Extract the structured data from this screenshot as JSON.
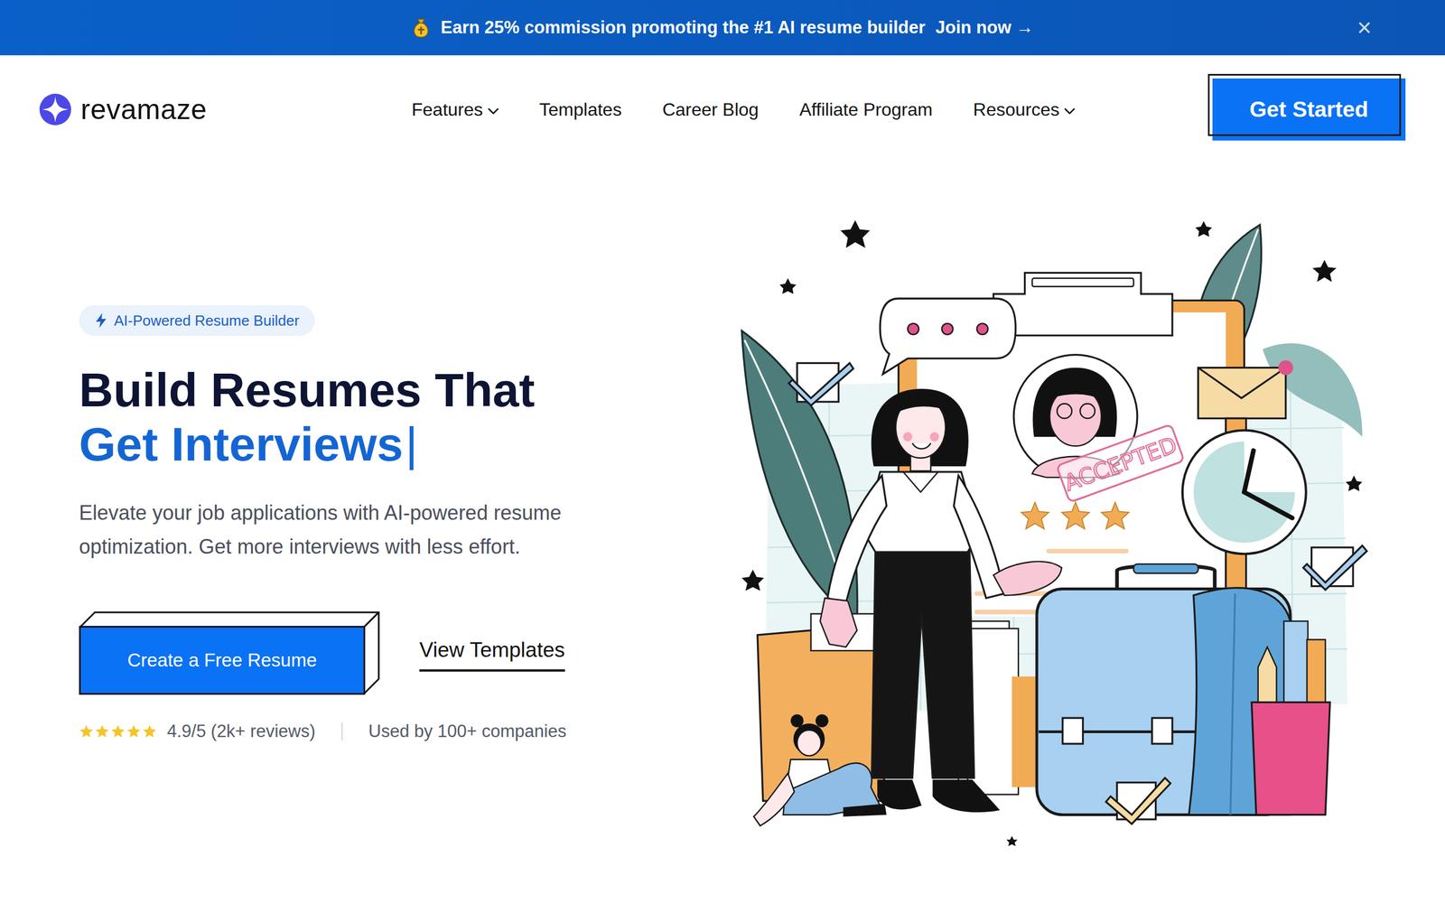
{
  "banner": {
    "text": "Earn 25% commission promoting the #1 AI resume builder",
    "link": "Join now →",
    "close": "×"
  },
  "logo": {
    "name": "revamaze"
  },
  "nav": [
    {
      "label": "Features",
      "dropdown": true
    },
    {
      "label": "Templates",
      "dropdown": false
    },
    {
      "label": "Career Blog",
      "dropdown": false
    },
    {
      "label": "Affiliate Program",
      "dropdown": false
    },
    {
      "label": "Resources",
      "dropdown": true
    }
  ],
  "cta": "Get Started",
  "hero": {
    "badge": "AI-Powered Resume Builder",
    "title_line1": "Build Resumes That",
    "title_line2": "Get Interviews",
    "cursor": "|",
    "subtitle": "Elevate your job applications with AI-powered resume optimization. Get more interviews with less effort.",
    "primary": "Create a Free Resume",
    "secondary": "View Templates",
    "rating": {
      "stars": 5,
      "text": "4.9/5 (2k+ reviews)"
    },
    "companies": "Used by 100+ companies"
  },
  "illustration": {
    "stamp": "ACCEPTED"
  }
}
